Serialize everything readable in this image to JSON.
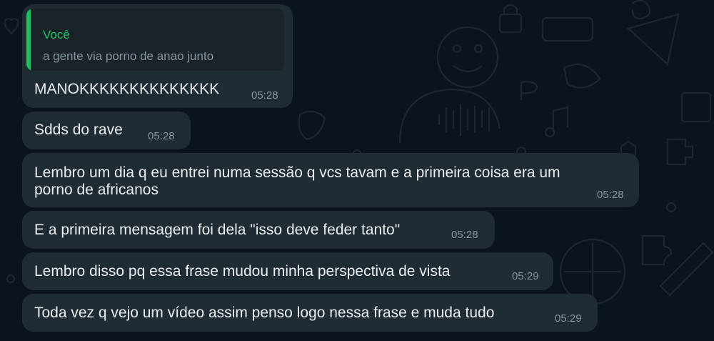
{
  "messages": [
    {
      "reply": {
        "author": "Você",
        "text": "a gente via porno de anao junto"
      },
      "lines": [
        "MANOKKKKKKKKKKKKKK"
      ],
      "time": "05:28"
    },
    {
      "lines": [
        "Sdds do rave"
      ],
      "time": "05:28"
    },
    {
      "lines": [
        "Lembro um dia q eu entrei numa sessão q vcs tavam e a primeira coisa era um",
        "porno de africanos"
      ],
      "time": "05:28"
    },
    {
      "lines": [
        "E a primeira mensagem foi dela \"isso deve feder tanto\""
      ],
      "time": "05:28"
    },
    {
      "lines": [
        "Lembro disso pq essa frase mudou minha perspectiva de vista"
      ],
      "time": "05:29"
    },
    {
      "lines": [
        "Toda vez q vejo um vídeo assim penso logo nessa frase e muda tudo"
      ],
      "time": "05:29"
    }
  ]
}
